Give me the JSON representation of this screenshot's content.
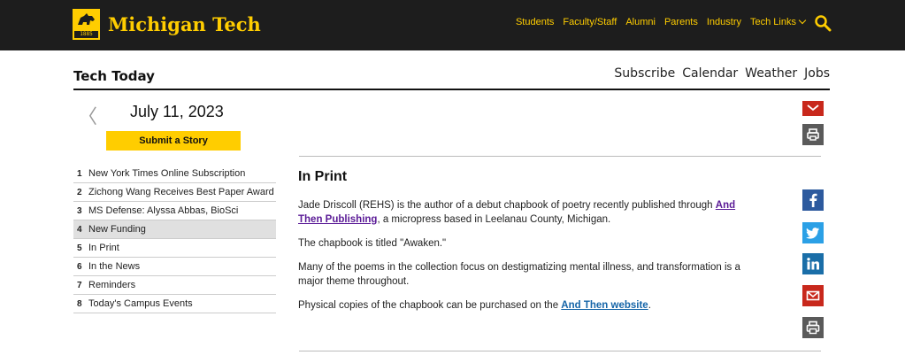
{
  "header": {
    "brand": "Michigan Tech",
    "brand_year": "1885",
    "nav": [
      "Students",
      "Faculty/Staff",
      "Alumni",
      "Parents",
      "Industry",
      "Tech Links"
    ]
  },
  "section": {
    "title": "Tech Today",
    "links": [
      "Subscribe",
      "Calendar",
      "Weather",
      "Jobs"
    ]
  },
  "date": {
    "label": "July 11, 2023",
    "prev_glyph": "〈"
  },
  "submit_label": "Submit a Story",
  "toc": [
    {
      "num": "1",
      "label": "New York Times Online Subscription"
    },
    {
      "num": "2",
      "label": "Zichong Wang Receives Best Paper Award"
    },
    {
      "num": "3",
      "label": "MS Defense: Alyssa Abbas, BioSci"
    },
    {
      "num": "4",
      "label": "New Funding"
    },
    {
      "num": "5",
      "label": "In Print"
    },
    {
      "num": "6",
      "label": "In the News"
    },
    {
      "num": "7",
      "label": "Reminders"
    },
    {
      "num": "8",
      "label": "Today's Campus Events"
    }
  ],
  "article": {
    "title": "In Print",
    "p1_a": "Jade Driscoll (REHS) is the author of a debut chapbook of poetry recently published through ",
    "p1_link": "And Then Publishing",
    "p1_b": ", a micropress based in Leelanau County, Michigan.",
    "p2": "The chapbook is titled \"Awaken.\"",
    "p3": "Many of the poems in the collection focus on destigmatizing mental illness, and transformation is a major theme throughout.",
    "p4_a": "Physical copies of the chapbook can be purchased on the ",
    "p4_link": "And Then website",
    "p4_b": "."
  },
  "colors": {
    "brand_gold": "#ffcd00",
    "header_bg": "#1d1d1d",
    "link_blue": "#1565a8",
    "link_visited": "#5a1a96",
    "facebook": "#2d5a9e",
    "twitter": "#2ba0e6",
    "linkedin": "#1a6ea8",
    "email": "#c8281c",
    "print": "#5a5a5a"
  },
  "icons": [
    "husky-logo-icon",
    "chevron-down-icon",
    "search-icon",
    "chevron-left-icon",
    "facebook-icon",
    "twitter-icon",
    "linkedin-icon",
    "email-icon",
    "print-icon"
  ]
}
